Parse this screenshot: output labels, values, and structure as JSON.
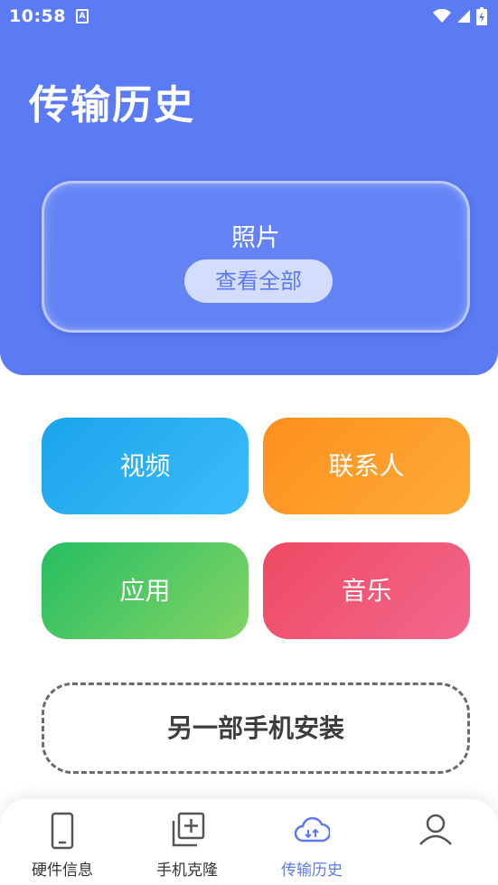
{
  "status_bar": {
    "time": "10:58",
    "app_badge": "A"
  },
  "header": {
    "title": "传输历史"
  },
  "photo_card": {
    "title": "照片",
    "view_all_label": "查看全部"
  },
  "tiles": {
    "video": "视频",
    "contacts": "联系人",
    "apps": "应用",
    "music": "音乐"
  },
  "install_button": {
    "label": "另一部手机安装"
  },
  "bottom_nav": {
    "items": [
      {
        "label": "硬件信息",
        "icon": "phone-icon",
        "active": false
      },
      {
        "label": "手机克隆",
        "icon": "clone-plus-icon",
        "active": false
      },
      {
        "label": "传输历史",
        "icon": "cloud-transfer-icon",
        "active": true
      },
      {
        "label": "",
        "icon": "profile-icon",
        "active": false
      }
    ]
  },
  "colors": {
    "primary": "#5b7bf4",
    "video": "#1ba4ea",
    "contacts": "#fd8f1f",
    "apps": "#26be62",
    "music": "#ee4a62"
  }
}
